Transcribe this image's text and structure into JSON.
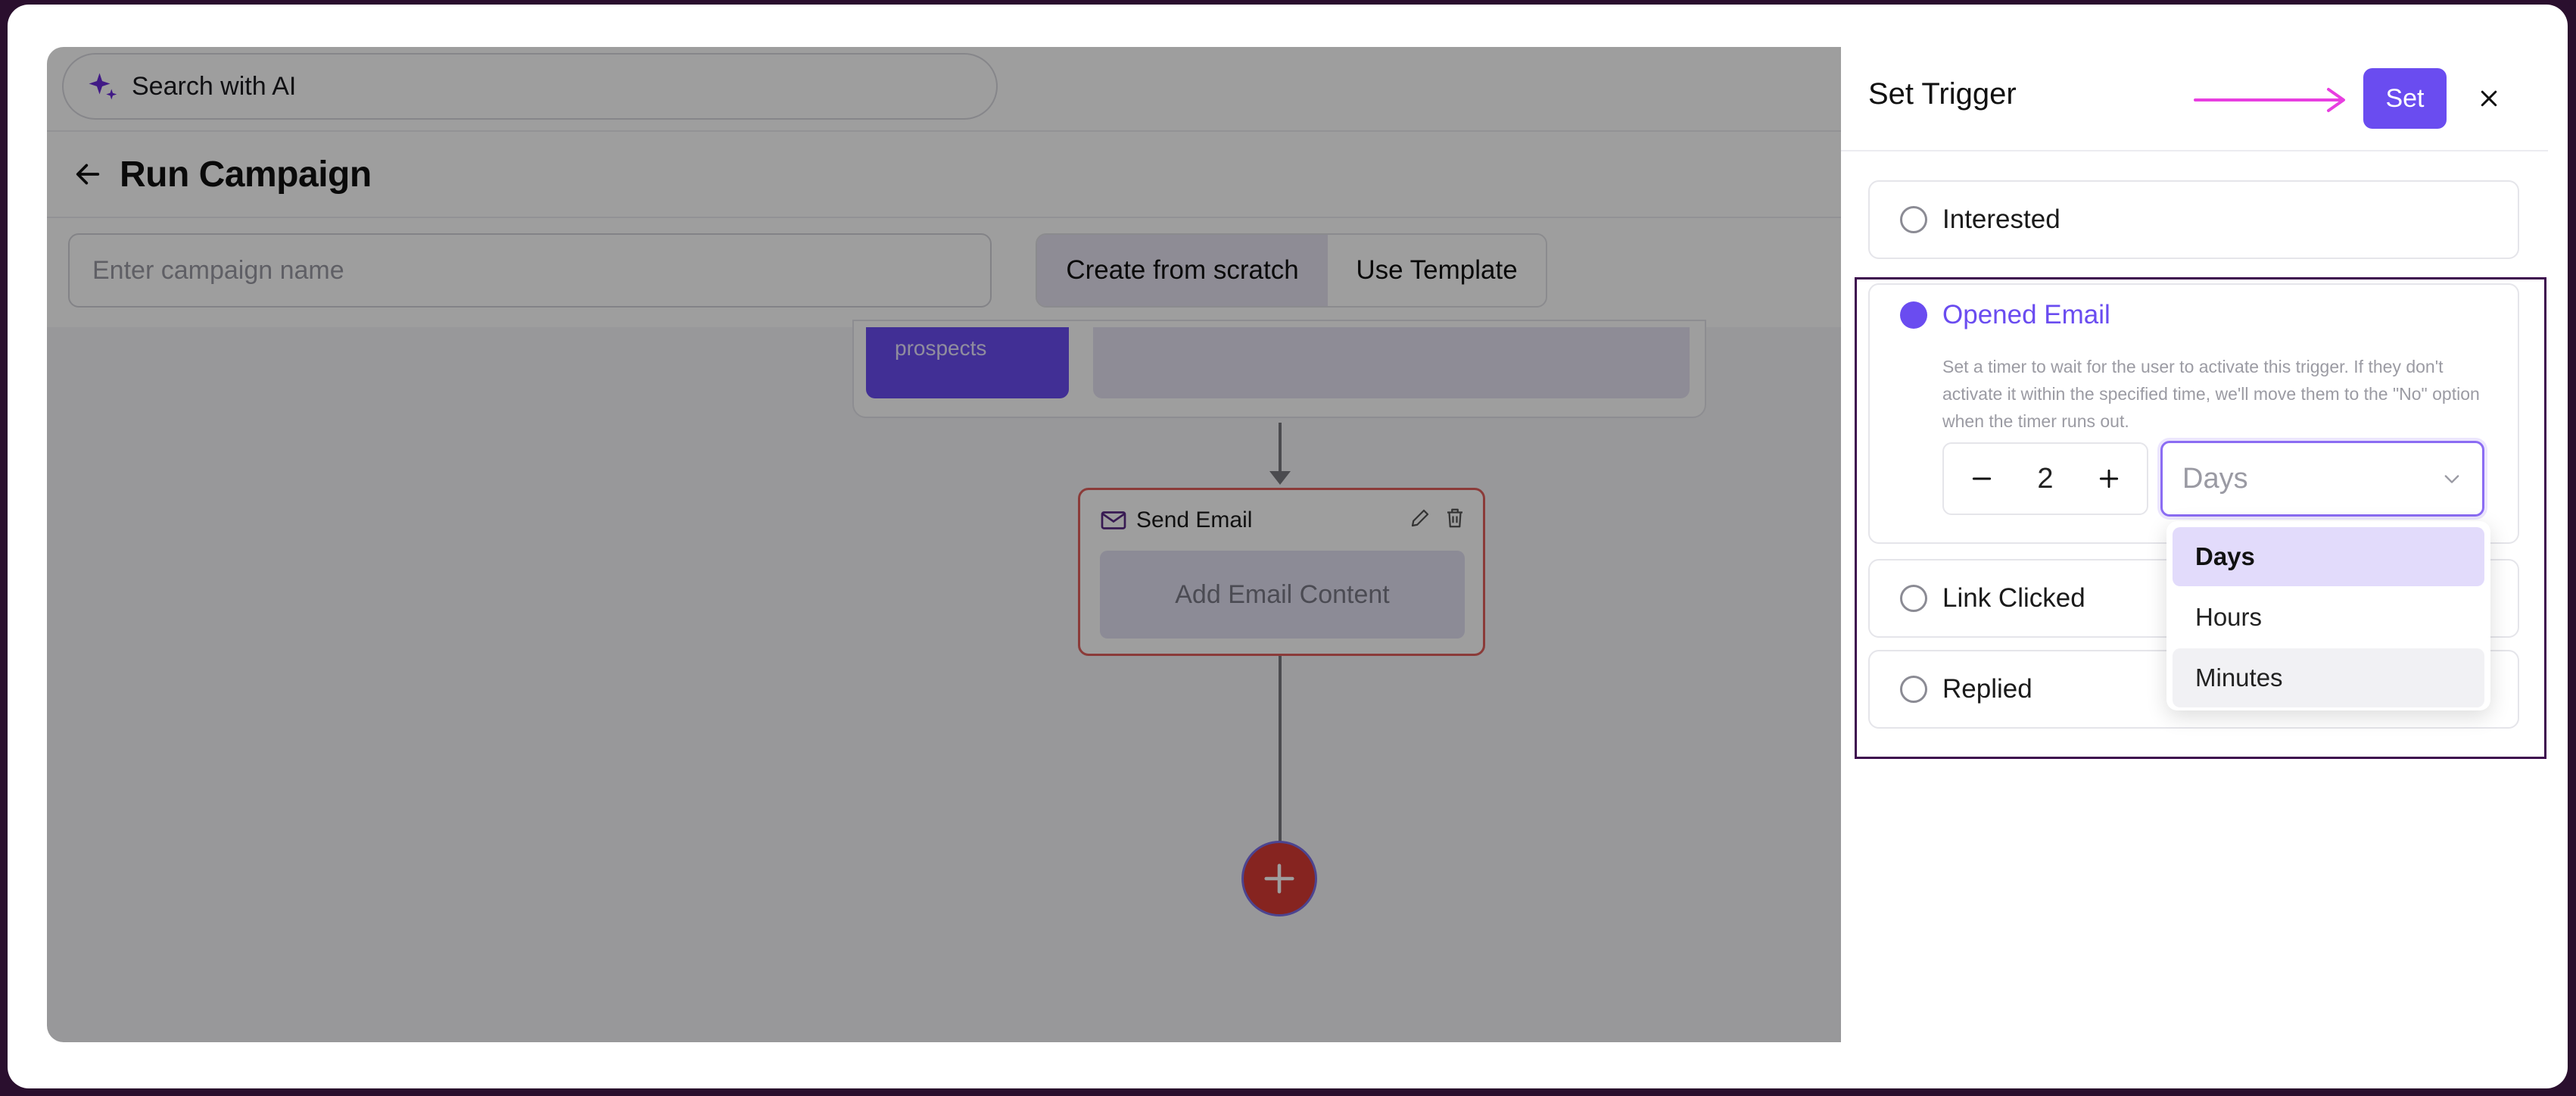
{
  "app": {
    "search_label": "Search with AI",
    "page_title": "Run Campaign",
    "campaign_name_placeholder": "Enter campaign name",
    "create_mode": {
      "options": [
        "Create from scratch",
        "Use Template"
      ],
      "selected": "Create from scratch"
    }
  },
  "canvas": {
    "prev_node_label": "prospects",
    "email_node": {
      "title": "Send Email",
      "content_button": "Add Email Content"
    }
  },
  "panel": {
    "title": "Set Trigger",
    "set_button": "Set",
    "options": [
      {
        "label": "Interested",
        "checked": false
      },
      {
        "label": "Opened Email",
        "checked": true
      },
      {
        "label": "Link Clicked",
        "checked": false
      },
      {
        "label": "Replied",
        "checked": false
      }
    ],
    "description": "Set a timer to wait for the user to activate this trigger. If they don't activate it within the specified time, we'll move them to the \"No\" option when the timer runs out.",
    "timer_value": "2",
    "unit_placeholder": "Days",
    "unit_options": [
      "Days",
      "Hours",
      "Minutes"
    ],
    "unit_selected": "Days"
  },
  "colors": {
    "accent": "#6a4cf0",
    "node_border": "#e0605c",
    "add_button": "#d83a35",
    "annotation_arrow": "#e83ee0"
  }
}
